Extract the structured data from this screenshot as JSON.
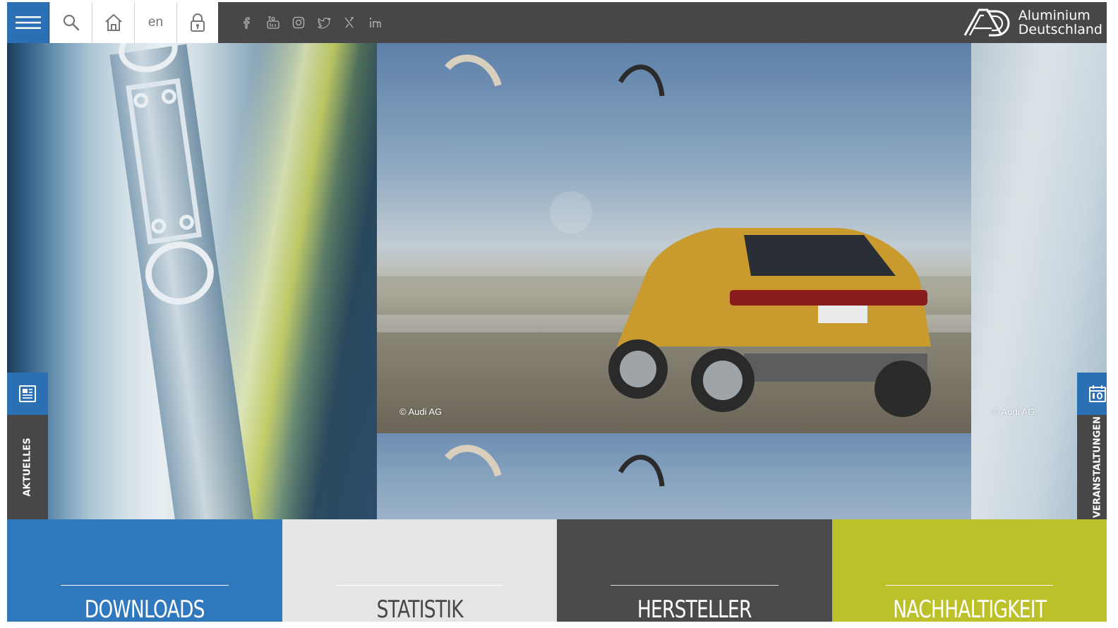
{
  "header": {
    "menu_icon": "hamburger-menu-icon",
    "search_icon": "search-icon",
    "home_icon": "home-icon",
    "language_label": "en",
    "lock_icon": "lock-icon",
    "social": [
      {
        "name": "facebook-icon"
      },
      {
        "name": "youtube-icon"
      },
      {
        "name": "instagram-icon"
      },
      {
        "name": "twitter-icon"
      },
      {
        "name": "x-icon"
      },
      {
        "name": "linkedin-icon"
      }
    ],
    "logo": {
      "line1": "Aluminium",
      "line2": "Deutschland"
    }
  },
  "hero": {
    "copyright_center": "© Audi AG",
    "copyright_right": "© Audi AG"
  },
  "side_tabs": {
    "left": {
      "label": "AKTUELLES",
      "icon": "newspaper-icon"
    },
    "right": {
      "label": "VERANSTALTUNGEN",
      "icon": "calendar-icon"
    }
  },
  "tiles": [
    {
      "label": "DOWNLOADS",
      "bg": "#2f78be",
      "fg": "#ffffff",
      "rule": "#ffffff"
    },
    {
      "label": "STATISTIK",
      "bg": "#e3e5e6",
      "fg": "#474747",
      "rule": "#ffffff"
    },
    {
      "label": "HERSTELLER",
      "bg": "#4a4a4a",
      "fg": "#ffffff",
      "rule": "#d9d9d9"
    },
    {
      "label": "NACHHALTIGKEIT",
      "bg": "#bcc12a",
      "fg": "#ffffff",
      "rule": "#ffffff"
    }
  ],
  "colors": {
    "header_bg": "#474747",
    "accent_blue": "#2b6fb4"
  }
}
